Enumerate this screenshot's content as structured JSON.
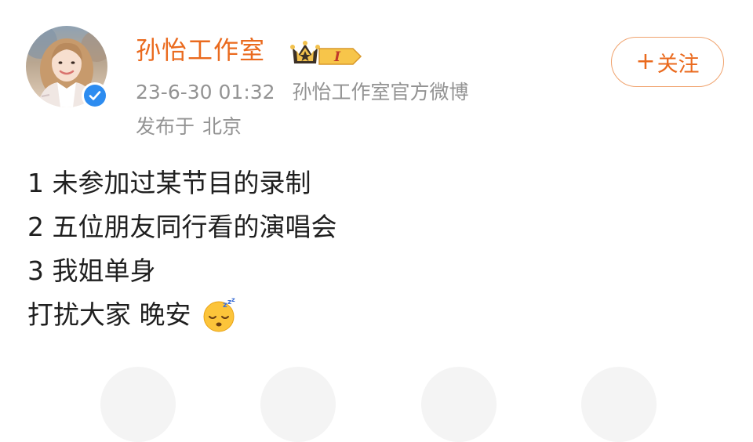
{
  "user": {
    "name": "孙怡工作室",
    "vip_level": "I",
    "verified": true
  },
  "meta": {
    "timestamp": "23-6-30 01:32",
    "source": "孙怡工作室官方微博",
    "location_prefix": "发布于",
    "location": "北京"
  },
  "follow_button": {
    "plus": "+",
    "label": "关注"
  },
  "post": {
    "lines": [
      "1 未参加过某节目的录制",
      "2 五位朋友同行看的演唱会",
      "3 我姐单身",
      "打扰大家 晚安"
    ],
    "emoji": "sleeping-face-icon"
  },
  "colors": {
    "accent_orange": "#ea6a1e",
    "meta_gray": "#939393",
    "verified_blue": "#2d8cf0",
    "follow_border": "#f0a36e"
  },
  "icons": {
    "verified": "verified-check-icon",
    "vip": "vip-crown-icon"
  }
}
